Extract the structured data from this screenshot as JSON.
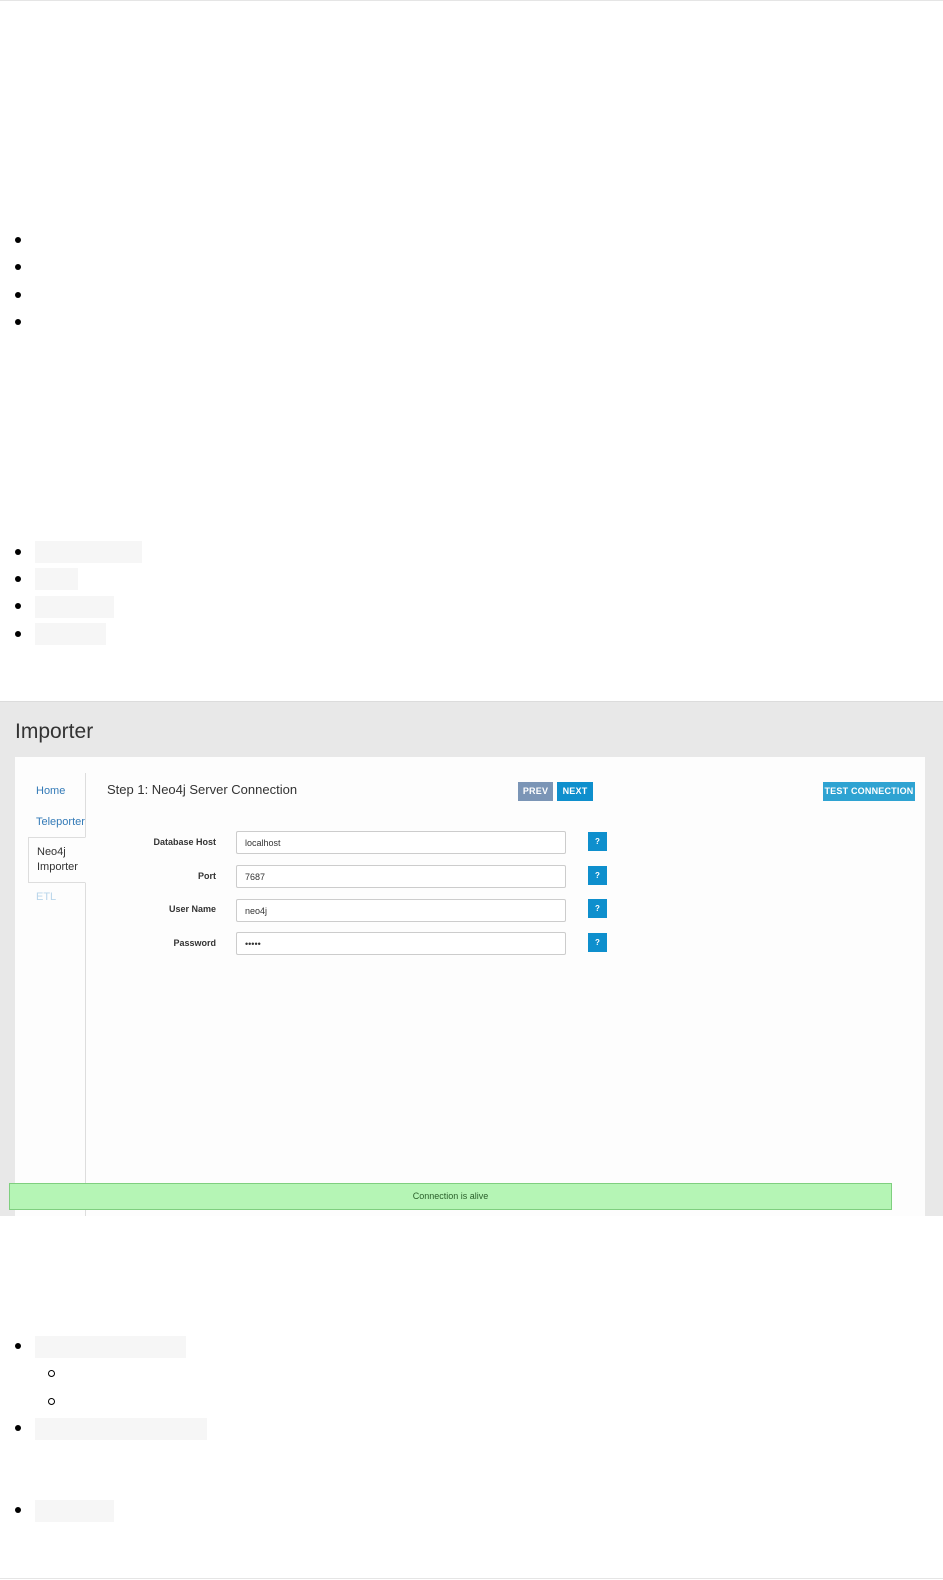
{
  "importer": {
    "title": "Importer",
    "sidebar": {
      "items": [
        {
          "label": "Home"
        },
        {
          "label": "Teleporter"
        },
        {
          "label": "Neo4j Importer"
        },
        {
          "label": "ETL"
        }
      ]
    },
    "step_title": "Step 1: Neo4j Server Connection",
    "buttons": {
      "prev": "PREV",
      "next": "NEXT",
      "test_connection": "TEST CONNECTION"
    },
    "form": {
      "fields": [
        {
          "label": "Database Host",
          "value": "localhost"
        },
        {
          "label": "Port",
          "value": "7687"
        },
        {
          "label": "User Name",
          "value": "neo4j"
        },
        {
          "label": "Password",
          "value": "•••••"
        }
      ],
      "help_label": "?"
    },
    "status_message": "Connection is alive"
  }
}
